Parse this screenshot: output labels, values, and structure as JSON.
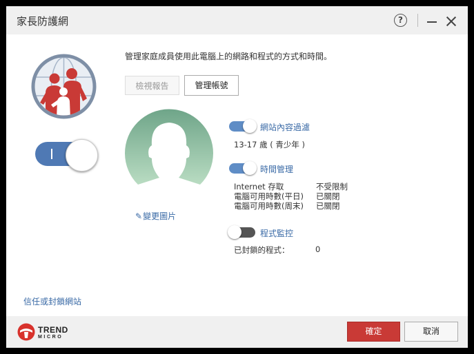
{
  "window": {
    "title": "家長防護網",
    "help_symbol": "?"
  },
  "main": {
    "description": "管理家庭成員使用此電腦上的網路和程式的方式和時間。",
    "btn_report": "檢視報告",
    "btn_account": "管理帳號",
    "change_picture": "變更圖片",
    "protection_toggle": "on",
    "protection_toggle_symbol": "I"
  },
  "features": {
    "web_filter": {
      "label": "網站內容過濾",
      "state": "on",
      "detail": "13-17 歲 ( 青少年 )"
    },
    "time": {
      "label": "時間管理",
      "state": "on",
      "rows": [
        {
          "name": "Internet 存取",
          "value": "不受限制"
        },
        {
          "name": "電腦可用時數(平日)",
          "value": "已關閉"
        },
        {
          "name": "電腦可用時數(周末)",
          "value": "已關閉"
        }
      ]
    },
    "program": {
      "label": "程式監控",
      "state": "off",
      "blocked_label": "已封鎖的程式：",
      "blocked_count": "0"
    }
  },
  "trust_link": "信任或封鎖網站",
  "footer": {
    "brand_name": "TREND",
    "brand_sub": "MICRO",
    "ok": "確定",
    "cancel": "取消"
  },
  "colors": {
    "accent_blue": "#4f79b4",
    "link_blue": "#3a6aa6",
    "ok_red": "#c93a36",
    "avatar_green": "#8fc2a0"
  }
}
